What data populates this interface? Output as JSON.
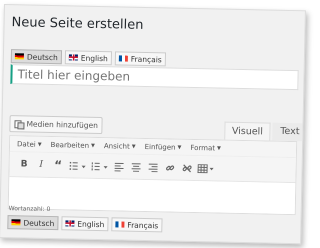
{
  "page": {
    "title": "Neue Seite erstellen"
  },
  "languages": [
    {
      "code": "de",
      "label": "Deutsch",
      "active": true
    },
    {
      "code": "en",
      "label": "English",
      "active": false
    },
    {
      "code": "fr",
      "label": "Français",
      "active": false
    }
  ],
  "title_input": {
    "placeholder": "Titel hier eingeben",
    "value": ""
  },
  "editor": {
    "media_button_label": "Medien hinzufügen",
    "tabs": {
      "visual": "Visuell",
      "text": "Text"
    },
    "menu": [
      "Datei",
      "Bearbeiten",
      "Ansicht",
      "Einfügen",
      "Format"
    ],
    "toolbar_icons": [
      "bold-icon",
      "italic-icon",
      "blockquote-icon",
      "bullet-list-icon",
      "numbered-list-icon",
      "align-left-icon",
      "align-center-icon",
      "align-right-icon",
      "link-icon",
      "unlink-icon",
      "table-icon"
    ],
    "toolbar_glyphs": {
      "bold": "B",
      "italic": "I",
      "blockquote": "“"
    },
    "word_count": "Wortanzahl: 0"
  },
  "colors": {
    "accent": "#16a085",
    "background": "#f1f1f1"
  }
}
